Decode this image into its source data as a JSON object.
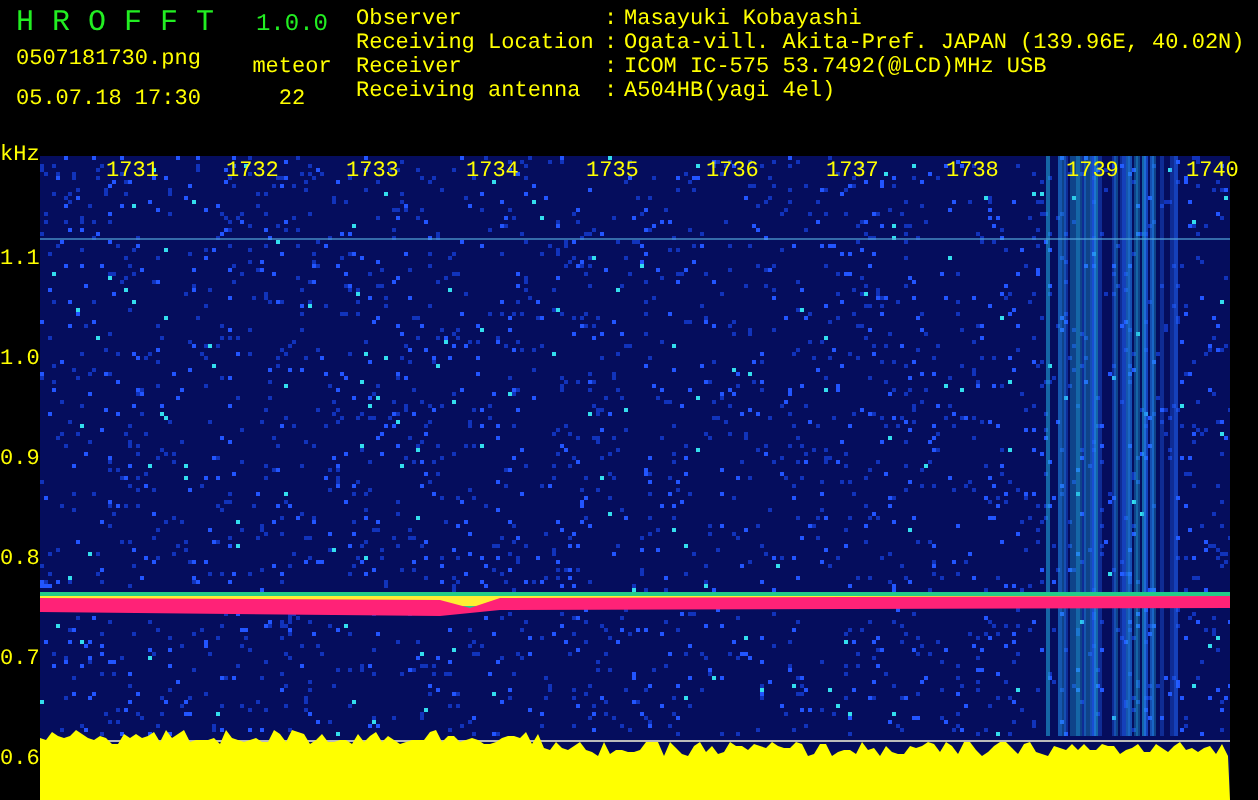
{
  "app": {
    "title": "H R O F F T",
    "version": "1.0.0",
    "filename": "0507181730.png",
    "datetime": "05.07.18 17:30"
  },
  "meteor": {
    "label": "meteor",
    "count": "22"
  },
  "info": [
    {
      "label": "Observer",
      "separator": ":",
      "value": "Masayuki Kobayashi"
    },
    {
      "label": "Receiving Location",
      "separator": ":",
      "value": "Ogata-vill. Akita-Pref. JAPAN (139.96E, 40.02N)"
    },
    {
      "label": "Receiver",
      "separator": ":",
      "value": "ICOM IC-575 53.7492(@LCD)MHz USB"
    },
    {
      "label": "Receiving antenna",
      "separator": ":",
      "value": "A504HB(yagi 4el)"
    }
  ],
  "spectrogram": {
    "unit": "kHz",
    "time_labels": [
      "1731",
      "1732",
      "1733",
      "1734",
      "1735",
      "1736",
      "1737",
      "1738",
      "1739",
      "1740"
    ],
    "frequency_labels": [
      "1.1",
      "1.0",
      "0.9",
      "0.8",
      "0.7",
      "0.6"
    ]
  }
}
